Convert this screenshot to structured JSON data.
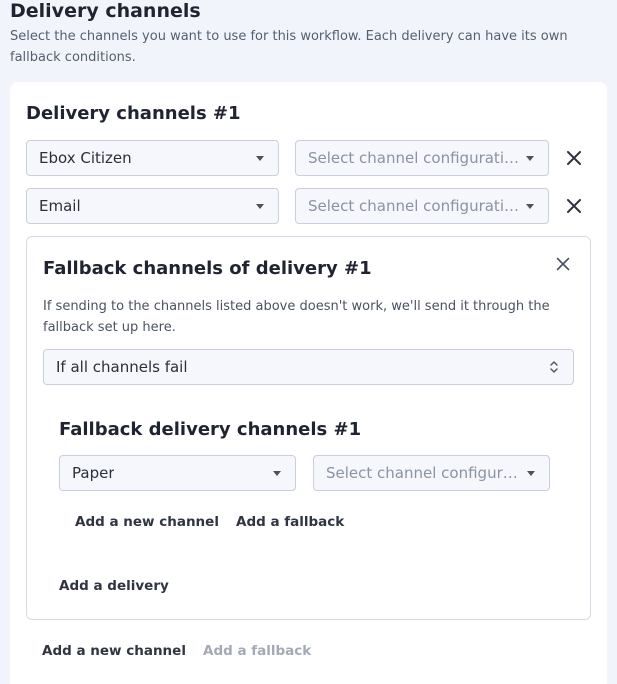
{
  "page": {
    "title": "Delivery channels",
    "description": "Select the channels you want to use for this workflow. Each delivery can have its own fallback conditions."
  },
  "delivery": {
    "title": "Delivery channels #1",
    "rows": [
      {
        "channel": "Ebox Citizen",
        "config_placeholder": "Select channel configuration"
      },
      {
        "channel": "Email",
        "config_placeholder": "Select channel configuration"
      }
    ],
    "add_channel_label": "Add a new channel",
    "add_fallback_label": "Add a fallback"
  },
  "fallback": {
    "title": "Fallback channels of delivery #1",
    "description": "If sending to the channels listed above doesn't work, we'll send it through the fallback set up here.",
    "condition": "If all channels fail",
    "delivery_title": "Fallback delivery channels #1",
    "channel": "Paper",
    "config_placeholder": "Select channel configurat...",
    "add_channel_label": "Add a new channel",
    "add_fallback_label": "Add a fallback",
    "add_delivery_label": "Add a delivery"
  },
  "icons": {
    "remove": "close-icon",
    "dropdown": "chevron-down-icon",
    "sort": "up-down-icon"
  },
  "colors": {
    "background": "#f1f4fa",
    "card": "#ffffff",
    "field": "#f5f7fc",
    "border": "#c9d0dc",
    "disabled_text": "#a3aab6"
  }
}
